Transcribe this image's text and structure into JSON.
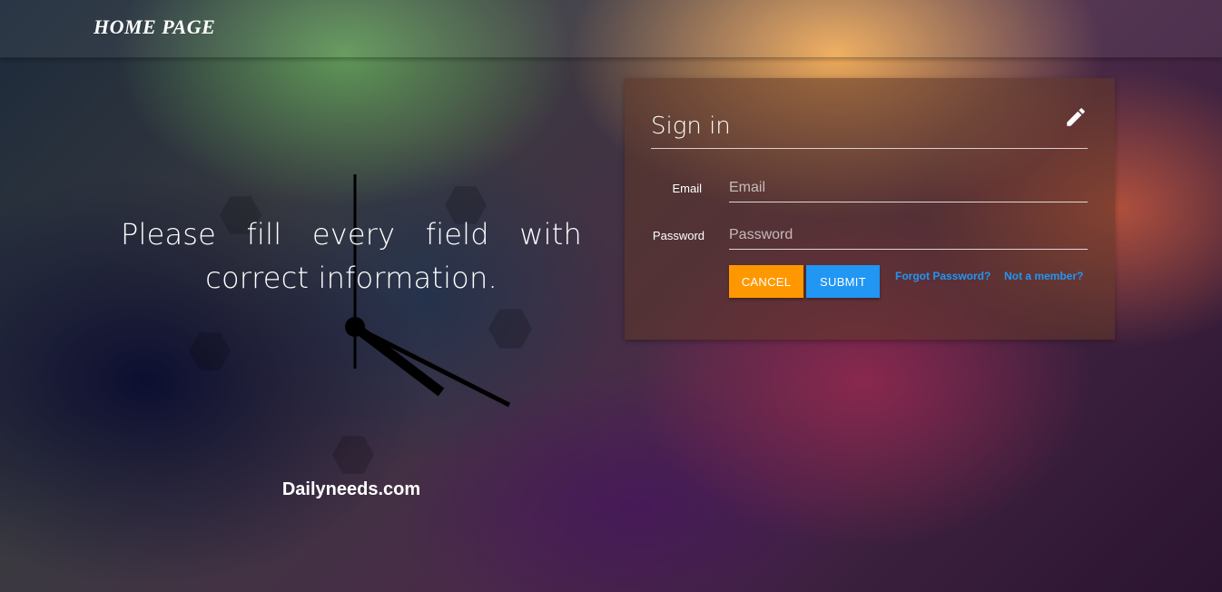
{
  "header": {
    "brand": "HOME PAGE"
  },
  "hero": {
    "tagline": "Please fill every field with correct information.",
    "site_name": "Dailyneeds.com"
  },
  "signin": {
    "title": "Sign in",
    "edit_icon": "pencil-icon",
    "email_label": "Email",
    "email_placeholder": "Email",
    "email_value": "",
    "password_label": "Password",
    "password_placeholder": "Password",
    "password_value": "",
    "cancel_label": "CANCEL",
    "submit_label": "SUBMIT",
    "forgot_link": "Forgot Password?",
    "member_link": "Not a member?"
  },
  "colors": {
    "cancel_button": "#ff9800",
    "submit_button": "#2196f3",
    "link": "#2196f3"
  }
}
